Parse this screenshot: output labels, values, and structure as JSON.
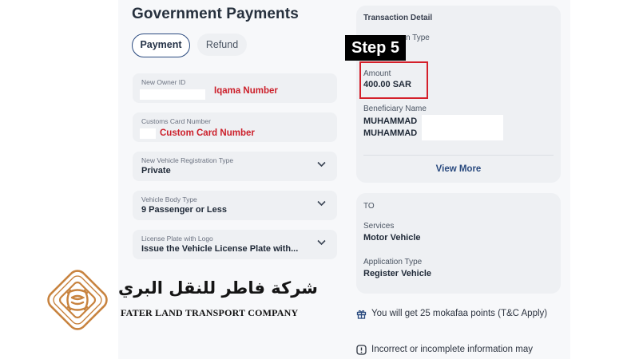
{
  "page": {
    "title": "Government Payments"
  },
  "tabs": [
    {
      "label": "Payment",
      "active": true
    },
    {
      "label": "Refund",
      "active": false
    }
  ],
  "form": {
    "owner_id": {
      "label": "New Owner ID",
      "note": "Iqama Number"
    },
    "customs_card": {
      "label": "Customs Card Number",
      "note": "Custom Card Number"
    },
    "registration_type": {
      "label": "New Vehicle Registration Type",
      "value": "Private"
    },
    "body_type": {
      "label": "Vehicle Body Type",
      "value": "9 Passenger or Less"
    },
    "license_plate": {
      "label": "License Plate with Logo",
      "value": "Issue the Vehicle License Plate with..."
    }
  },
  "detail": {
    "header": "Transaction Detail",
    "type_label_visible": "n Type",
    "amount_label": "Amount",
    "amount_value": "400.00 SAR",
    "beneficiary_label": "Beneficiary Name",
    "beneficiary_line1": "MUHAMMAD",
    "beneficiary_line2": "MUHAMMAD",
    "view_more": "View More"
  },
  "to": {
    "header": "TO",
    "services_label": "Services",
    "services_value": "Motor Vehicle",
    "application_label": "Application Type",
    "application_value": "Register Vehicle"
  },
  "notices": {
    "points": "You will get 25 mokafaa points (T&C Apply)",
    "warning": "Incorrect or incomplete information may"
  },
  "annotation": {
    "step": "Step 5"
  },
  "brand": {
    "arabic": "شركة فاطر للنقل البري",
    "english": "FATER LAND TRANSPORT COMPANY",
    "logo_color": "#c8833f"
  },
  "colors": {
    "accent": "#2a4a7f",
    "highlight_red": "#d41f2a",
    "note_red": "#cc1f2a"
  }
}
